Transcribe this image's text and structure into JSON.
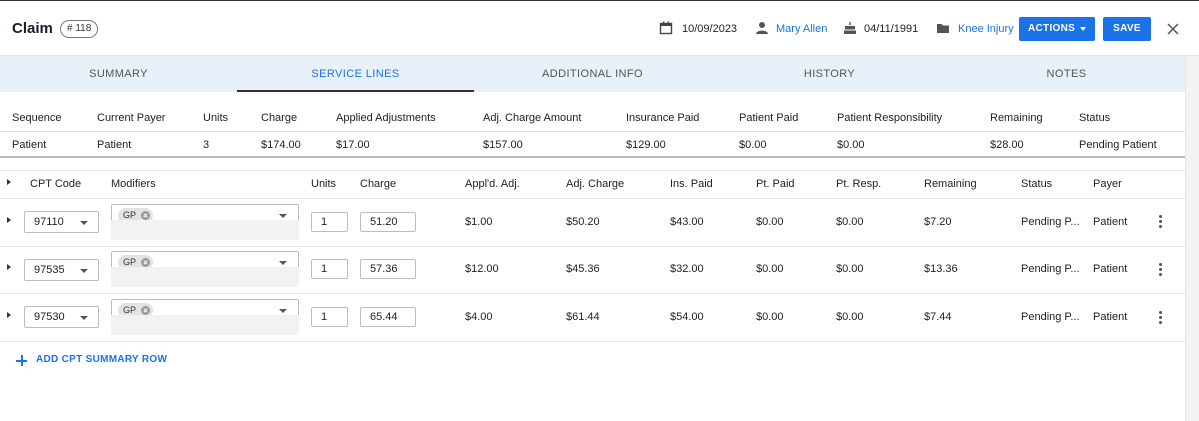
{
  "header": {
    "title": "Claim",
    "claim_number": "# 118",
    "date": "10/09/2023",
    "patient_name": "Mary Allen",
    "dob": "04/11/1991",
    "case_name": "Knee Injury",
    "actions_label": "ACTIONS",
    "save_label": "SAVE",
    "icons": [
      "calendar-icon",
      "person-icon",
      "cake-icon",
      "folder-icon",
      "close-icon"
    ],
    "accent_color": "#1a73e8"
  },
  "tabs": [
    {
      "label": "SUMMARY",
      "active": false
    },
    {
      "label": "SERVICE LINES",
      "active": true
    },
    {
      "label": "ADDITIONAL INFO",
      "active": false
    },
    {
      "label": "HISTORY",
      "active": false
    },
    {
      "label": "NOTES",
      "active": false
    }
  ],
  "summary": {
    "headers": [
      "Sequence",
      "Current Payer",
      "Units",
      "Charge",
      "Applied Adjustments",
      "Adj. Charge Amount",
      "Insurance Paid",
      "Patient Paid",
      "Patient Responsibility",
      "Remaining",
      "Status"
    ],
    "row": [
      "Patient",
      "Patient",
      "3",
      "$174.00",
      "$17.00",
      "$157.00",
      "$129.00",
      "$0.00",
      "$0.00",
      "$28.00",
      "Pending Patient"
    ]
  },
  "service_lines": {
    "headers": [
      "CPT Code",
      "Modifiers",
      "Units",
      "Charge",
      "Appl'd. Adj.",
      "Adj. Charge",
      "Ins. Paid",
      "Pt. Paid",
      "Pt. Resp.",
      "Remaining",
      "Status",
      "Payer"
    ],
    "rows": [
      {
        "cpt": "97110",
        "modifier": "GP",
        "units": "1",
        "charge": "51.20",
        "appl_adj": "$1.00",
        "adj_charge": "$50.20",
        "ins_paid": "$43.00",
        "pt_paid": "$0.00",
        "pt_resp": "$0.00",
        "remaining": "$7.20",
        "status": "Pending P...",
        "payer": "Patient"
      },
      {
        "cpt": "97535",
        "modifier": "GP",
        "units": "1",
        "charge": "57.36",
        "appl_adj": "$12.00",
        "adj_charge": "$45.36",
        "ins_paid": "$32.00",
        "pt_paid": "$0.00",
        "pt_resp": "$0.00",
        "remaining": "$13.36",
        "status": "Pending P...",
        "payer": "Patient"
      },
      {
        "cpt": "97530",
        "modifier": "GP",
        "units": "1",
        "charge": "65.44",
        "appl_adj": "$4.00",
        "adj_charge": "$61.44",
        "ins_paid": "$54.00",
        "pt_paid": "$0.00",
        "pt_resp": "$0.00",
        "remaining": "$7.44",
        "status": "Pending P...",
        "payer": "Patient"
      }
    ],
    "add_row_label": "ADD CPT SUMMARY ROW"
  }
}
